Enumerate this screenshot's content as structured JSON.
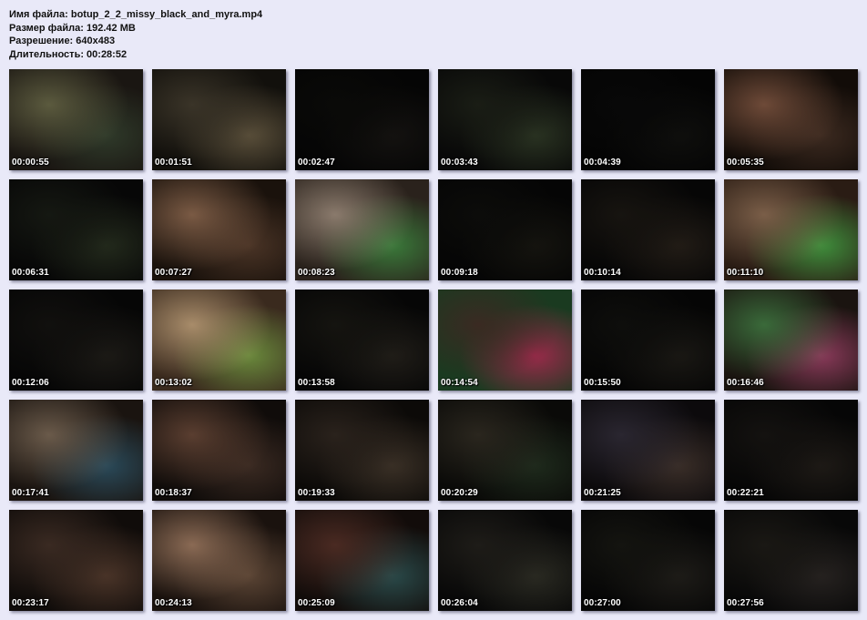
{
  "file_info": {
    "name_line": "Имя файла: botup_2_2_missy_black_and_myra.mp4",
    "size_line": "Размер файла: 192.42 MB",
    "resolution_line": "Разрешение: 640x483",
    "duration_line": "Длительность: 00:28:52"
  },
  "thumbnails": [
    {
      "time": "00:00:55",
      "colors": [
        "#5b5a3e",
        "#2f3a2a",
        "#1a1612"
      ]
    },
    {
      "time": "00:01:51",
      "colors": [
        "#3a3428",
        "#5a4f3a",
        "#12100c"
      ]
    },
    {
      "time": "00:02:47",
      "colors": [
        "#0a0a08",
        "#141210",
        "#050505"
      ]
    },
    {
      "time": "00:03:43",
      "colors": [
        "#1a1d15",
        "#2a3322",
        "#080808"
      ]
    },
    {
      "time": "00:04:39",
      "colors": [
        "#080808",
        "#0f0f0d",
        "#040404"
      ]
    },
    {
      "time": "00:05:35",
      "colors": [
        "#6e4a38",
        "#3c2a20",
        "#120c08"
      ]
    },
    {
      "time": "00:06:31",
      "colors": [
        "#151812",
        "#232a1c",
        "#070707"
      ]
    },
    {
      "time": "00:07:27",
      "colors": [
        "#7a5a44",
        "#4a3426",
        "#1a120c"
      ]
    },
    {
      "time": "00:08:23",
      "colors": [
        "#8a7a6c",
        "#3a7a3a",
        "#2a221c"
      ]
    },
    {
      "time": "00:09:18",
      "colors": [
        "#0c0c0a",
        "#15140f",
        "#050505"
      ]
    },
    {
      "time": "00:10:14",
      "colors": [
        "#171410",
        "#221c16",
        "#060606"
      ]
    },
    {
      "time": "00:11:10",
      "colors": [
        "#7a5e48",
        "#3f8f3c",
        "#2a1c14"
      ]
    },
    {
      "time": "00:12:06",
      "colors": [
        "#11100e",
        "#1c1a16",
        "#060606"
      ]
    },
    {
      "time": "00:13:02",
      "colors": [
        "#a88c6a",
        "#6a8a3c",
        "#3a2a1e"
      ]
    },
    {
      "time": "00:13:58",
      "colors": [
        "#151410",
        "#201d18",
        "#060606"
      ]
    },
    {
      "time": "00:14:54",
      "colors": [
        "#3a2a22",
        "#9a2a4a",
        "#1a3a20"
      ]
    },
    {
      "time": "00:15:50",
      "colors": [
        "#0e0e0c",
        "#1a1814",
        "#050505"
      ]
    },
    {
      "time": "00:16:46",
      "colors": [
        "#3a6a3a",
        "#8a3a5a",
        "#1a1410"
      ]
    },
    {
      "time": "00:17:41",
      "colors": [
        "#6a5a4a",
        "#2a4a5a",
        "#1a1410"
      ]
    },
    {
      "time": "00:18:37",
      "colors": [
        "#5a3e30",
        "#3a2a22",
        "#100c0a"
      ]
    },
    {
      "time": "00:19:33",
      "colors": [
        "#2a221c",
        "#3a3026",
        "#0c0a08"
      ]
    },
    {
      "time": "00:20:29",
      "colors": [
        "#2a261e",
        "#1e2a1c",
        "#0a0a08"
      ]
    },
    {
      "time": "00:21:25",
      "colors": [
        "#2a2630",
        "#3a2e28",
        "#0c0a0c"
      ]
    },
    {
      "time": "00:22:21",
      "colors": [
        "#141210",
        "#1e1a16",
        "#060606"
      ]
    },
    {
      "time": "00:23:17",
      "colors": [
        "#3a2a22",
        "#4a3428",
        "#100c0a"
      ]
    },
    {
      "time": "00:24:13",
      "colors": [
        "#8a6a54",
        "#5a4434",
        "#1a120e"
      ]
    },
    {
      "time": "00:25:09",
      "colors": [
        "#4a2a22",
        "#2a4a4a",
        "#120c0a"
      ]
    },
    {
      "time": "00:26:04",
      "colors": [
        "#1e1c18",
        "#2a2a22",
        "#080808"
      ]
    },
    {
      "time": "00:27:00",
      "colors": [
        "#141410",
        "#1e1c18",
        "#060606"
      ]
    },
    {
      "time": "00:27:56",
      "colors": [
        "#1a1814",
        "#262220",
        "#080808"
      ]
    }
  ]
}
